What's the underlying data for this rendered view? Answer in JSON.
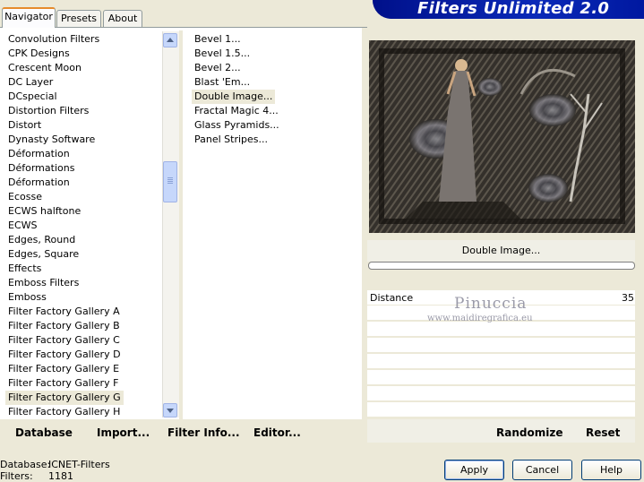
{
  "tabs": [
    {
      "label": "Navigator",
      "active": true
    },
    {
      "label": "Presets",
      "active": false
    },
    {
      "label": "About",
      "active": false
    }
  ],
  "banner_title": "Filters Unlimited 2.0",
  "categories": [
    "Convolution Filters",
    "CPK Designs",
    "Crescent Moon",
    "DC Layer",
    "DCspecial",
    "Distortion Filters",
    "Distort",
    "Dynasty Software",
    "Déformation",
    "Déformations",
    "Déformation",
    "Ecosse",
    "ECWS halftone",
    "ECWS",
    "Edges, Round",
    "Edges, Square",
    "Effects",
    "Emboss Filters",
    "Emboss",
    "Filter Factory Gallery A",
    "Filter Factory Gallery B",
    "Filter Factory Gallery C",
    "Filter Factory Gallery D",
    "Filter Factory Gallery E",
    "Filter Factory Gallery F",
    "Filter Factory Gallery G",
    "Filter Factory Gallery H"
  ],
  "selected_category": "Filter Factory Gallery G",
  "filters": [
    "Bevel 1...",
    "Bevel 1.5...",
    "Bevel 2...",
    "Blast 'Em...",
    "Double Image...",
    "Fractal Magic 4...",
    "Glass Pyramids...",
    "Panel Stripes..."
  ],
  "selected_filter": "Double Image...",
  "filter_name": "Double Image...",
  "param": {
    "label": "Distance",
    "value": "35"
  },
  "watermark": {
    "line1": "Pinuccia",
    "line2": "www.maidiregrafica.eu"
  },
  "left_links": {
    "database": "Database",
    "import": "Import...",
    "filter_info": "Filter Info...",
    "editor": "Editor..."
  },
  "right_links": {
    "randomize": "Randomize",
    "reset": "Reset"
  },
  "status": {
    "database_label": "Database:",
    "database_value": "ICNET-Filters",
    "filters_label": "Filters:",
    "filters_value": "1181"
  },
  "buttons": {
    "apply": "Apply",
    "cancel": "Cancel",
    "help": "Help"
  },
  "colors": {
    "banner": "#0a2ab8",
    "tab_accent": "#e68b2c",
    "background": "#ece9d8"
  }
}
